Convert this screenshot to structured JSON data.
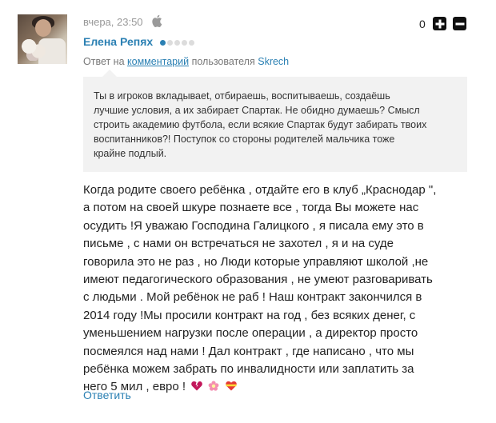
{
  "comment": {
    "time": "вчера, 23:50",
    "platform_icon": "apple-icon",
    "score": "0",
    "author": "Елена Репях",
    "rating_filled": 1,
    "rating_total": 5,
    "reply_prefix": "Ответ на",
    "reply_link": "комментарий",
    "reply_middle": "пользователя",
    "reply_user": "Skrech",
    "quote_lines": [
      "Ты в игроков вкладываеt, отбираешь, воспитываешь, создаёшь",
      "лучшие условия, а их забирает Спартак. Не обидно думаешь? Смысл",
      "строить академию футбола, если всякие Спартак будут забирать твоих",
      "воспитанников?! Поступок со стороны родителей мальчика тоже",
      "крайне подлый."
    ],
    "body_lines": [
      "Когда родите своего ребёнка , отдайте его в клуб „Краснодар \",",
      "а потом на своей шкуре познаете все , тогда Вы можете нас",
      "осудить !Я уважаю Господина Галицкого , я писала ему это в",
      "письме , с нами он встречаться не захотел , я и на суде",
      "говорила это не раз , но Люди которые управляют школой ,не",
      "имеют педагогического образования , не умеют разговаривать",
      "с людьми . Мой ребёнок не раб ! Наш контракт закончился в",
      "2014 году !Мы просили контракт на год , без всяких денег, с",
      "уменьшением нагрузки после операции , а директор просто",
      "посмеялся над нами ! Дал контракт , где написано , что мы",
      "ребёнка можем забрать по инвалидности или заплатить за",
      "него 5 мил , евро !"
    ],
    "emojis": [
      "broken-heart-icon",
      "flower-icon",
      "heart-ribbon-icon"
    ],
    "reply_button": "Ответить"
  }
}
